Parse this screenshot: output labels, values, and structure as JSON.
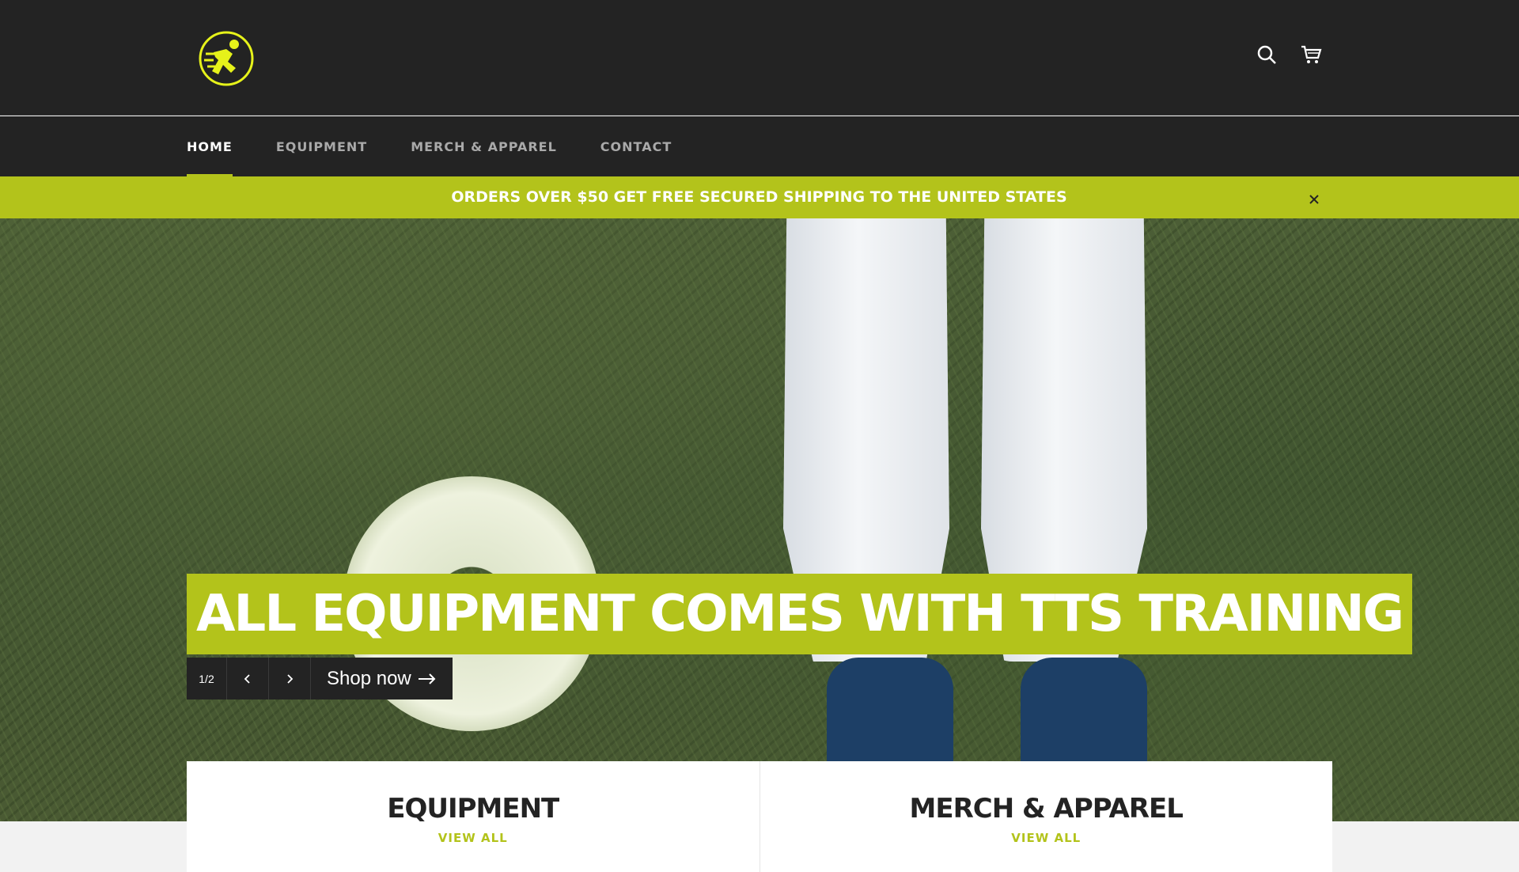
{
  "brand": {
    "logo_icon": "sprinter-logo-icon",
    "accent": "#b3c31b",
    "dark": "#232323"
  },
  "header": {
    "search_icon": "search-icon",
    "cart_icon": "cart-icon"
  },
  "nav": {
    "items": [
      {
        "label": "HOME",
        "active": true
      },
      {
        "label": "EQUIPMENT",
        "active": false
      },
      {
        "label": "MERCH & APPAREL",
        "active": false
      },
      {
        "label": "CONTACT",
        "active": false
      }
    ]
  },
  "promo": {
    "text": "ORDERS OVER $50 GET FREE SECURED SHIPPING TO THE UNITED STATES",
    "close_icon": "close-icon"
  },
  "hero": {
    "title": "ALL EQUIPMENT COMES WITH TTS TRAINING",
    "slide_counter": "1/2",
    "prev_icon": "chevron-left-icon",
    "next_icon": "chevron-right-icon",
    "cta_label": "Shop now",
    "cta_icon": "arrow-right-icon"
  },
  "collections": [
    {
      "title": "EQUIPMENT",
      "link": "VIEW ALL"
    },
    {
      "title": "MERCH & APPAREL",
      "link": "VIEW ALL"
    }
  ]
}
